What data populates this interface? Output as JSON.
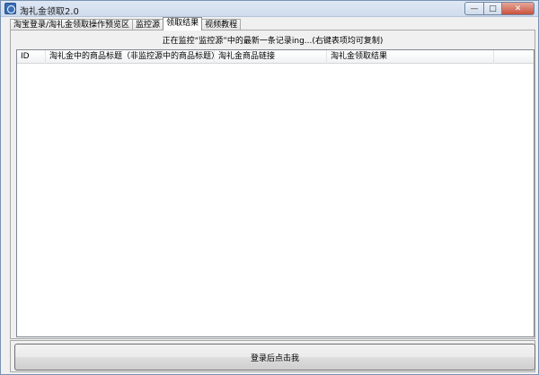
{
  "window": {
    "title": "淘礼金领取2.0",
    "controls": {
      "minimize": "—",
      "maximize": "□",
      "close": "✕"
    },
    "icon": "app-icon"
  },
  "tabs": [
    {
      "label": "淘宝登录/淘礼金领取操作预览区",
      "active": false
    },
    {
      "label": "监控源",
      "active": false
    },
    {
      "label": "领取结果",
      "active": true
    },
    {
      "label": "视频教程",
      "active": false
    }
  ],
  "results_panel": {
    "notice": "正在监控“监控源”中的最新一条记录ing...(右键表项均可复制)",
    "columns": [
      "ID",
      "淘礼金中的商品标题（非监控源中的商品标题）",
      "淘礼金商品链接",
      "淘礼金领取结果"
    ],
    "rows": []
  },
  "action": {
    "button_label": "登录后点击我"
  }
}
